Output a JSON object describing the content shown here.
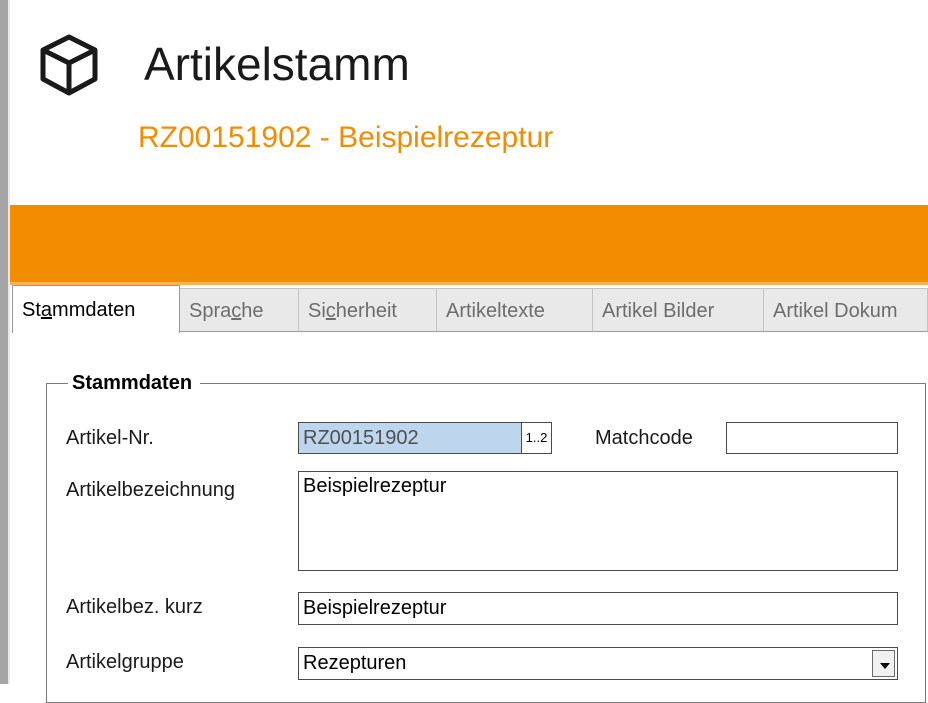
{
  "header": {
    "title": "Artikelstamm",
    "subtitle": "RZ00151902 - Beispielrezeptur",
    "icon": "box-icon"
  },
  "colors": {
    "accent": "#f28c00",
    "selection": "#bdd6ee"
  },
  "tabs": [
    {
      "label_pre": "St",
      "label_u": "a",
      "label_post": "mmdaten",
      "active": true
    },
    {
      "label_pre": "Spra",
      "label_u": "c",
      "label_post": "he",
      "active": false
    },
    {
      "label_pre": "Si",
      "label_u": "c",
      "label_post": "herheit",
      "active": false
    },
    {
      "label_pre": "",
      "label_u": "",
      "label_post": "Artikeltexte",
      "active": false
    },
    {
      "label_pre": "",
      "label_u": "",
      "label_post": "Artikel Bilder",
      "active": false
    },
    {
      "label_pre": "",
      "label_u": "",
      "label_post": "Artikel Dokum",
      "active": false
    }
  ],
  "form": {
    "group_title": "Stammdaten",
    "artikel_nr": {
      "label": "Artikel-Nr.",
      "value": "RZ00151902",
      "numbering_button": "1..2"
    },
    "matchcode": {
      "label": "Matchcode",
      "value": ""
    },
    "artikelbezeichnung": {
      "label": "Artikelbezeichnung",
      "value": "Beispielrezeptur"
    },
    "artikelbez_kurz": {
      "label": "Artikelbez. kurz",
      "value": "Beispielrezeptur"
    },
    "artikelgruppe": {
      "label": "Artikelgruppe",
      "value": "Rezepturen"
    }
  }
}
